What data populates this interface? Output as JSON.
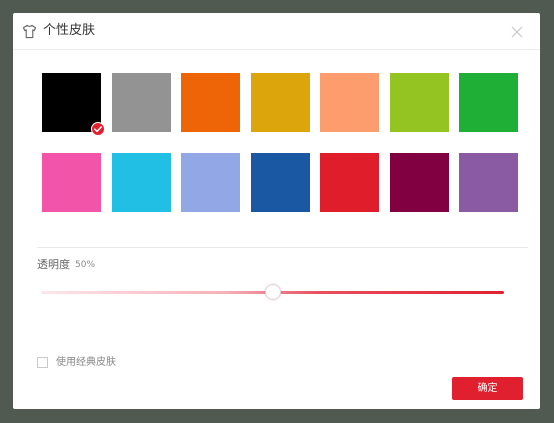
{
  "dialog": {
    "title": "个性皮肤",
    "title_icon": "tshirt-icon",
    "close_icon": "close-icon"
  },
  "skins": [
    {
      "color": "#000000",
      "selected": true
    },
    {
      "color": "#939393",
      "selected": false
    },
    {
      "color": "#ee6508",
      "selected": false
    },
    {
      "color": "#dca50b",
      "selected": false
    },
    {
      "color": "#fd9d6d",
      "selected": false
    },
    {
      "color": "#94c422",
      "selected": false
    },
    {
      "color": "#20af36",
      "selected": false
    },
    {
      "color": "#f254aa",
      "selected": false
    },
    {
      "color": "#20bfe3",
      "selected": false
    },
    {
      "color": "#92a7e5",
      "selected": false
    },
    {
      "color": "#1b58a3",
      "selected": false
    },
    {
      "color": "#e01d2b",
      "selected": false
    },
    {
      "color": "#810041",
      "selected": false
    },
    {
      "color": "#8a5aa2",
      "selected": false
    }
  ],
  "selected_badge_icon": "checkmark-icon",
  "opacity": {
    "label": "透明度",
    "value_text": "50%",
    "value": 0.5
  },
  "classic_skin": {
    "label": "使用经典皮肤",
    "checked": false
  },
  "confirm_label": "确定",
  "colors": {
    "accent": "#e0202f",
    "backdrop": "#515a51"
  }
}
